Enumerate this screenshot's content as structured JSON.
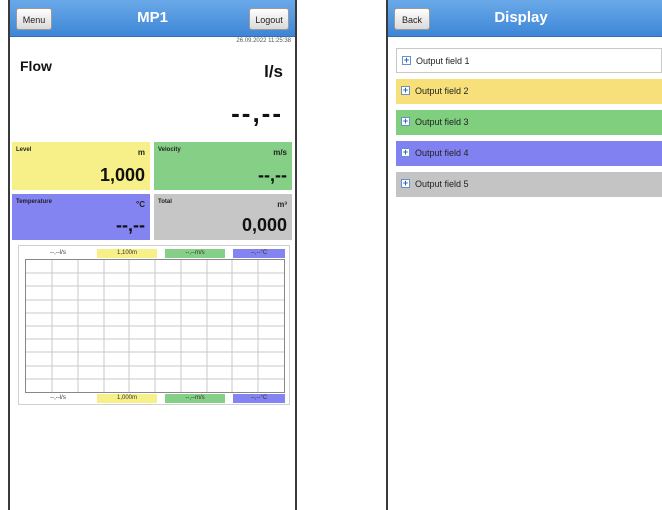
{
  "left_screen": {
    "menu_label": "Menu",
    "title": "MP1",
    "logout_label": "Logout",
    "datetime": "26.09.2022 11:25:38",
    "flow": {
      "label": "Flow",
      "unit": "l/s",
      "value": "--,--"
    },
    "tiles": [
      {
        "label": "Level",
        "unit": "m",
        "value": "1,000",
        "color": "#f7ef88"
      },
      {
        "label": "Velocity",
        "unit": "m/s",
        "value": "--,--",
        "color": "#86cf86"
      },
      {
        "label": "Temperature",
        "unit": "°C",
        "value": "--,--",
        "color": "#8383f2"
      },
      {
        "label": "Total",
        "unit": "m³",
        "value": "0,000",
        "color": "#c6c6c6"
      }
    ],
    "chart": {
      "top_legend": [
        "--,--l/s",
        "1,100m",
        "--,--m/s",
        "--,--°C"
      ],
      "bottom_legend": [
        "--,--l/s",
        "1,000m",
        "--,--m/s",
        "--,--°C"
      ]
    }
  },
  "right_screen": {
    "back_label": "Back",
    "title": "Display",
    "items": [
      {
        "label": "Output field 1",
        "color": "#ffffff"
      },
      {
        "label": "Output field 2",
        "color": "#f7e07a"
      },
      {
        "label": "Output field 3",
        "color": "#7fcf7f"
      },
      {
        "label": "Output field 4",
        "color": "#8181f2"
      },
      {
        "label": "Output field 5",
        "color": "#c4c4c4"
      }
    ]
  },
  "colors": {
    "titlebar": "#4a90dd",
    "legend_flow": "#ffffff",
    "legend_level": "#f7ef88",
    "legend_velocity": "#86cf86",
    "legend_temp": "#8383f2"
  }
}
